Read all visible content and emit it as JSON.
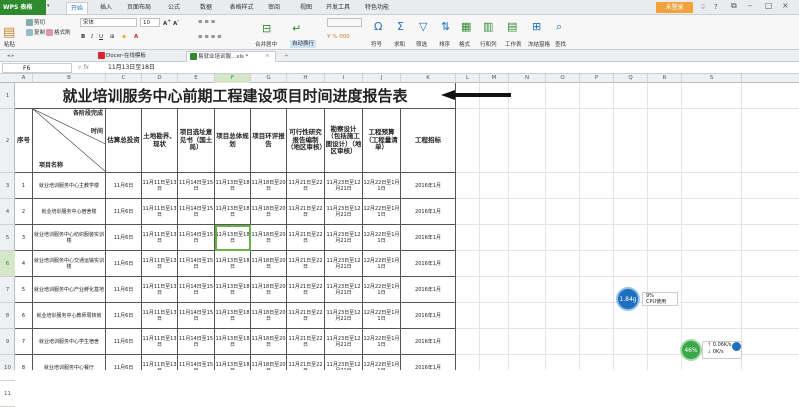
{
  "app": {
    "logo": "WPS 表格",
    "login": "未登录"
  },
  "menu": [
    "开始",
    "插入",
    "页面布局",
    "公式",
    "数据",
    "表格样式",
    "审阅",
    "视图",
    "开发工具",
    "特色功能"
  ],
  "ribbon": {
    "cut": "剪切",
    "copy": "复制",
    "format_painter": "格式刷",
    "paste": "粘贴",
    "font": "宋体",
    "font_size": "10",
    "merge": "合并居中",
    "wrap": "自动换行",
    "symbol": "符号",
    "sum": "求和",
    "filter": "筛选",
    "sort": "排序",
    "format": "格式",
    "rowcol": "行和列",
    "sheet": "工作表",
    "freeze": "冻结窗格",
    "find": "查找"
  },
  "doc_tabs": [
    "Docer-在线模板",
    "易就业培训服...xls *"
  ],
  "formula": {
    "cell_ref": "F6",
    "fx": "fx",
    "value": "11月13日至18日"
  },
  "columns": [
    "A",
    "B",
    "C",
    "D",
    "E",
    "F",
    "G",
    "H",
    "I",
    "J",
    "K",
    "L",
    "M",
    "N",
    "O",
    "P",
    "Q",
    "R",
    "S"
  ],
  "rows": [
    "1",
    "2",
    "3",
    "4",
    "5",
    "6",
    "7",
    "8",
    "9",
    "10",
    "11"
  ],
  "sheet": {
    "title": "就业培训服务中心前期工程建设项目时间进度报告表",
    "corner": {
      "top": "各阶段完成",
      "mid": "时间",
      "bottom": "项目名称"
    },
    "headers": [
      "序号",
      "估算总投资",
      "土地勘界、现状",
      "项目选址意见书（国土局）",
      "项目总体规划",
      "项目环评报告",
      "可行性研究报告编制（地区审核）",
      "勘察设计（包括施工图设计）（地区审核）",
      "工程预算（工程量清单）",
      "工程招标"
    ],
    "data": [
      {
        "no": "1",
        "name": "就业培训服务中心主教学楼",
        "c": "11月6日",
        "d": "11月11日至13日",
        "e": "11月14日至15日",
        "f": "11月13日至18日",
        "g": "11月18日至20日",
        "h": "11月21日至22日",
        "i": "11月23日至12月21日",
        "j": "12月22日至1月1日",
        "k": "2016年1月"
      },
      {
        "no": "2",
        "name": "就业培训服务中心宿舍楼",
        "c": "11月6日",
        "d": "11月11日至13日",
        "e": "11月14日至15日",
        "f": "11月13日至18日",
        "g": "11月18日至20日",
        "h": "11月21日至22日",
        "i": "11月23日至12月21日",
        "j": "12月22日至1月1日",
        "k": "2016年1月"
      },
      {
        "no": "3",
        "name": "就业培训服务中心纺织服装实训楼",
        "c": "11月6日",
        "d": "11月11日至13日",
        "e": "11月14日至15日",
        "f": "11月13日至18日",
        "g": "11月18日至20日",
        "h": "11月21日至22日",
        "i": "11月23日至12月21日",
        "j": "12月22日至1月1日",
        "k": "2016年1月"
      },
      {
        "no": "4",
        "name": "就业培训服务中心交通运输实训楼",
        "c": "11月6日",
        "d": "11月11日至13日",
        "e": "11月14日至15日",
        "f": "11月13日至18日",
        "g": "11月18日至20日",
        "h": "11月21日至22日",
        "i": "11月23日至12月21日",
        "j": "12月22日至1月1日",
        "k": "2016年1月"
      },
      {
        "no": "5",
        "name": "就业培训服务中心产业孵化基地",
        "c": "11月6日",
        "d": "11月11日至13日",
        "e": "11月14日至15日",
        "f": "11月13日至18日",
        "g": "11月18日至20日",
        "h": "11月21日至22日",
        "i": "11月23日至12月21日",
        "j": "12月22日至1月1日",
        "k": "2016年1月"
      },
      {
        "no": "6",
        "name": "就业培训服务中心教师周转房",
        "c": "11月6日",
        "d": "11月11日至13日",
        "e": "11月14日至15日",
        "f": "11月13日至18日",
        "g": "11月18日至20日",
        "h": "11月21日至22日",
        "i": "11月23日至12月21日",
        "j": "12月22日至1月1日",
        "k": "2016年1月"
      },
      {
        "no": "7",
        "name": "就业培训服务中心学生宿舍",
        "c": "11月6日",
        "d": "11月11日至13日",
        "e": "11月14日至15日",
        "f": "11月13日至18日",
        "g": "11月18日至20日",
        "h": "11月21日至22日",
        "i": "11月23日至12月21日",
        "j": "12月22日至1月1日",
        "k": "2016年1月"
      },
      {
        "no": "8",
        "name": "就业培训服务中心餐厅",
        "c": "11月6日",
        "d": "11月11日至13日",
        "e": "11月14日至15日",
        "f": "11月13日至18日",
        "g": "11月18日至20日",
        "h": "11月21日至22日",
        "i": "11月23日至12月21日",
        "j": "12月22日至1月1日",
        "k": "2016年1月"
      }
    ]
  },
  "widgets": {
    "cpu_value": "1.84g",
    "cpu_pct": "9%",
    "cpu_label": "CPU使用",
    "net_pct": "46%",
    "net_up": "0.06K/s",
    "net_down": "0K/s"
  },
  "colors": {
    "accent": "#2f8a2f",
    "login": "#f0a33b",
    "selected": "#6ab04c"
  }
}
